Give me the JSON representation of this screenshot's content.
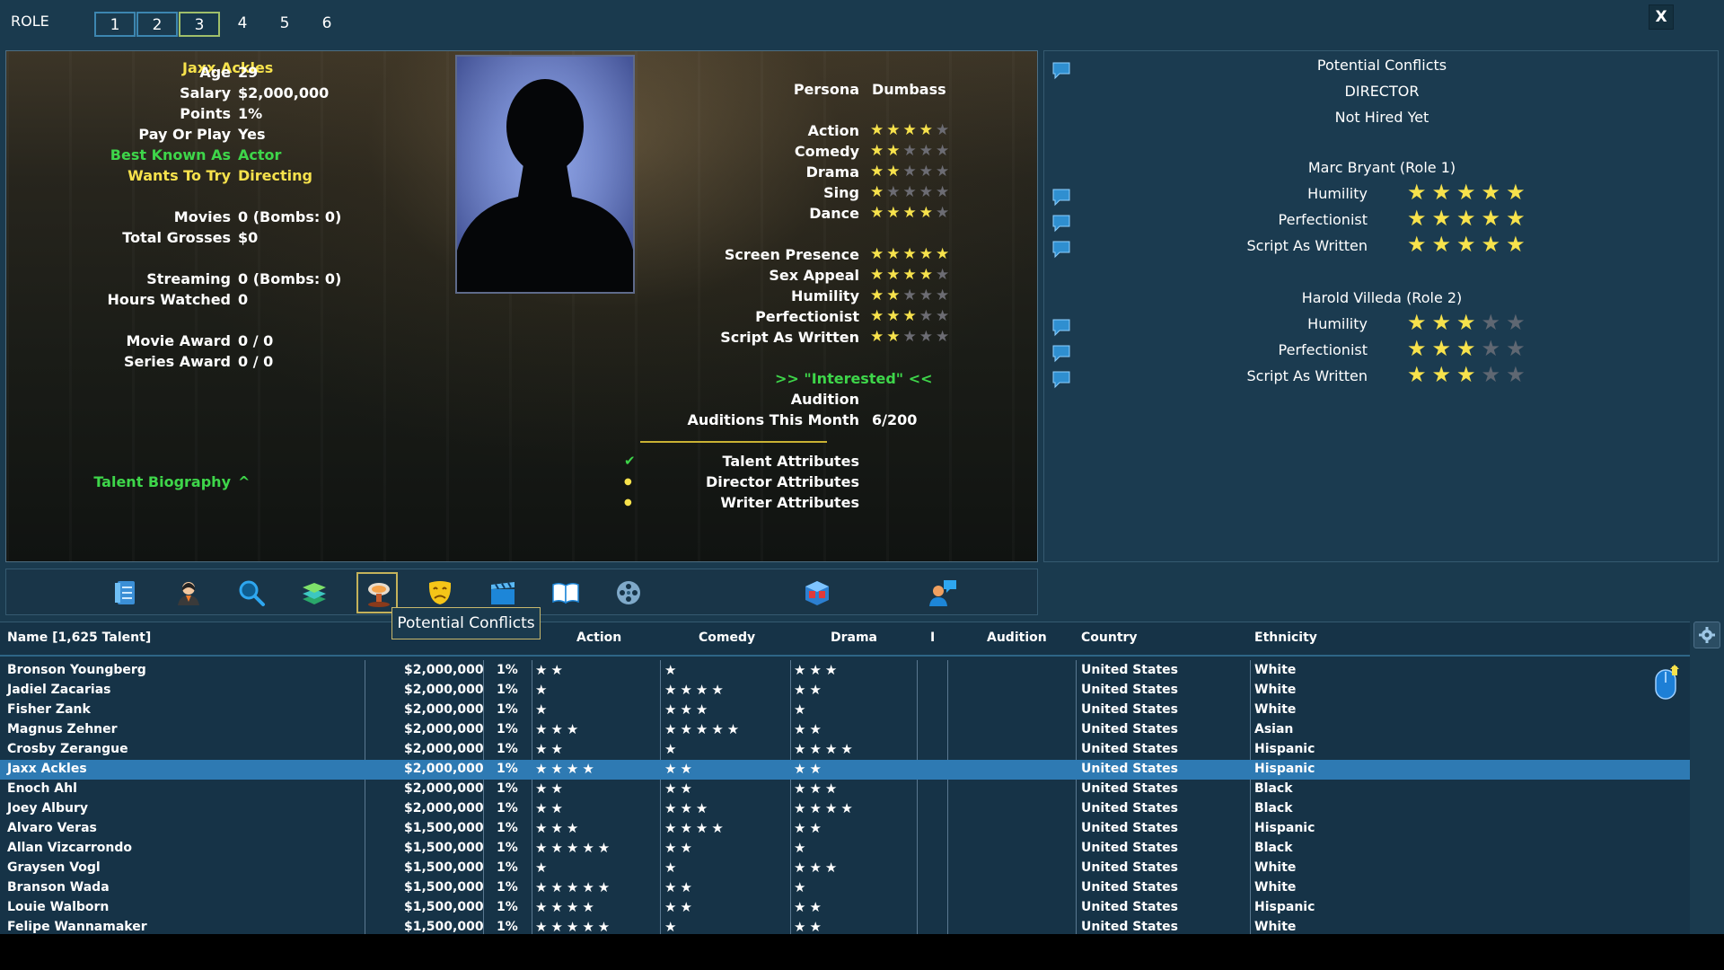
{
  "top": {
    "role_label": "ROLE",
    "roles": [
      "1",
      "2",
      "3",
      "4",
      "5",
      "6"
    ],
    "active_role": "3",
    "close_label": "X"
  },
  "talent": {
    "name": "Jaxx Ackles",
    "fields": [
      {
        "key": "Age",
        "value": "29"
      },
      {
        "key": "Salary",
        "value": "$2,000,000"
      },
      {
        "key": "Points",
        "value": "1%"
      },
      {
        "key": "Pay Or Play",
        "value": "Yes"
      },
      {
        "key": "Best Known As",
        "value": "Actor"
      },
      {
        "key": "Wants To Try",
        "value": "Directing"
      },
      {
        "key": "Movies",
        "value": "0 (Bombs: 0)"
      },
      {
        "key": "Total Grosses",
        "value": "$0"
      },
      {
        "key": "Streaming",
        "value": "0 (Bombs: 0)"
      },
      {
        "key": "Hours Watched",
        "value": "0"
      },
      {
        "key": "Movie Award",
        "value": "0 / 0"
      },
      {
        "key": "Series Award",
        "value": "0 / 0"
      }
    ],
    "biography_label": "Talent Biography",
    "biography_caret": "^",
    "persona_label": "Persona",
    "persona_value": "Dumbass",
    "skills": [
      {
        "label": "Action",
        "stars": 4
      },
      {
        "label": "Comedy",
        "stars": 2
      },
      {
        "label": "Drama",
        "stars": 2
      },
      {
        "label": "Sing",
        "stars": 1
      },
      {
        "label": "Dance",
        "stars": 4
      }
    ],
    "traits": [
      {
        "label": "Screen Presence",
        "stars": 5
      },
      {
        "label": "Sex Appeal",
        "stars": 4
      },
      {
        "label": "Humility",
        "stars": 2
      },
      {
        "label": "Perfectionist",
        "stars": 3
      },
      {
        "label": "Script As Written",
        "stars": 2
      }
    ],
    "interest": ">>  \"Interested\"  <<",
    "audition_label": "Audition",
    "auditions_label": "Auditions This Month",
    "auditions_value": "6/200",
    "attributes": [
      {
        "label": "Talent Attributes",
        "mark": "✔"
      },
      {
        "label": "Director Attributes",
        "mark": "●"
      },
      {
        "label": "Writer Attributes",
        "mark": "●"
      }
    ]
  },
  "conflicts": {
    "title": "Potential Conflicts",
    "role": "DIRECTOR",
    "status": "Not Hired Yet",
    "people": [
      {
        "name": "Marc Bryant (Role 1)",
        "traits": [
          {
            "label": "Humility",
            "stars": 5
          },
          {
            "label": "Perfectionist",
            "stars": 5
          },
          {
            "label": "Script As Written",
            "stars": 5
          }
        ]
      },
      {
        "name": "Harold Villeda (Role 2)",
        "traits": [
          {
            "label": "Humility",
            "stars": 3
          },
          {
            "label": "Perfectionist",
            "stars": 3
          },
          {
            "label": "Script As Written",
            "stars": 3
          }
        ]
      }
    ]
  },
  "toolbar": {
    "tooltip": "Potential Conflicts"
  },
  "table": {
    "headers": {
      "name": "Name [1,625 Talent]",
      "action": "Action",
      "comedy": "Comedy",
      "drama": "Drama",
      "i": "I",
      "audition": "Audition",
      "country": "Country",
      "ethnicity": "Ethnicity"
    },
    "rows": [
      {
        "name": "Bronson Youngberg",
        "salary": "$2,000,000",
        "points": "1%",
        "action": 2,
        "comedy": 1,
        "drama": 3,
        "country": "United States",
        "ethnicity": "White"
      },
      {
        "name": "Jadiel Zacarias",
        "salary": "$2,000,000",
        "points": "1%",
        "action": 1,
        "comedy": 4,
        "drama": 2,
        "country": "United States",
        "ethnicity": "White"
      },
      {
        "name": "Fisher Zank",
        "salary": "$2,000,000",
        "points": "1%",
        "action": 1,
        "comedy": 3,
        "drama": 1,
        "country": "United States",
        "ethnicity": "White"
      },
      {
        "name": "Magnus Zehner",
        "salary": "$2,000,000",
        "points": "1%",
        "action": 3,
        "comedy": 5,
        "drama": 2,
        "country": "United States",
        "ethnicity": "Asian"
      },
      {
        "name": "Crosby Zerangue",
        "salary": "$2,000,000",
        "points": "1%",
        "action": 2,
        "comedy": 1,
        "drama": 4,
        "country": "United States",
        "ethnicity": "Hispanic"
      },
      {
        "name": "Jaxx Ackles",
        "salary": "$2,000,000",
        "points": "1%",
        "action": 4,
        "comedy": 2,
        "drama": 2,
        "country": "United States",
        "ethnicity": "Hispanic",
        "selected": true
      },
      {
        "name": "Enoch Ahl",
        "salary": "$2,000,000",
        "points": "1%",
        "action": 2,
        "comedy": 2,
        "drama": 3,
        "country": "United States",
        "ethnicity": "Black"
      },
      {
        "name": "Joey Albury",
        "salary": "$2,000,000",
        "points": "1%",
        "action": 2,
        "comedy": 3,
        "drama": 4,
        "country": "United States",
        "ethnicity": "Black"
      },
      {
        "name": "Alvaro Veras",
        "salary": "$1,500,000",
        "points": "1%",
        "action": 3,
        "comedy": 4,
        "drama": 2,
        "country": "United States",
        "ethnicity": "Hispanic"
      },
      {
        "name": "Allan Vizcarrondo",
        "salary": "$1,500,000",
        "points": "1%",
        "action": 5,
        "comedy": 2,
        "drama": 1,
        "country": "United States",
        "ethnicity": "Black"
      },
      {
        "name": "Graysen Vogl",
        "salary": "$1,500,000",
        "points": "1%",
        "action": 1,
        "comedy": 1,
        "drama": 3,
        "country": "United States",
        "ethnicity": "White"
      },
      {
        "name": "Branson Wada",
        "salary": "$1,500,000",
        "points": "1%",
        "action": 5,
        "comedy": 2,
        "drama": 1,
        "country": "United States",
        "ethnicity": "White"
      },
      {
        "name": "Louie Walborn",
        "salary": "$1,500,000",
        "points": "1%",
        "action": 4,
        "comedy": 2,
        "drama": 2,
        "country": "United States",
        "ethnicity": "Hispanic"
      },
      {
        "name": "Felipe Wannamaker",
        "salary": "$1,500,000",
        "points": "1%",
        "action": 5,
        "comedy": 1,
        "drama": 2,
        "country": "United States",
        "ethnicity": "White"
      }
    ]
  },
  "colors": {
    "background": "#1a3a4e",
    "star_on": "#f7e24c",
    "star_off": "#6c6c73",
    "selected_row": "#2e7ab3",
    "green_text": "#3ed64a",
    "yellow_text": "#f7e24c"
  },
  "icons": [
    "notes-icon",
    "talent-profile-icon",
    "search-icon",
    "layers-icon",
    "explosion-icon",
    "drama-masks-icon",
    "clapperboard-icon",
    "book-icon",
    "film-reel-icon",
    "3d-view-icon",
    "talent-chat-icon",
    "chat-bubble-icon",
    "gear-icon",
    "scroll-mouse-icon",
    "silhouette-icon"
  ]
}
